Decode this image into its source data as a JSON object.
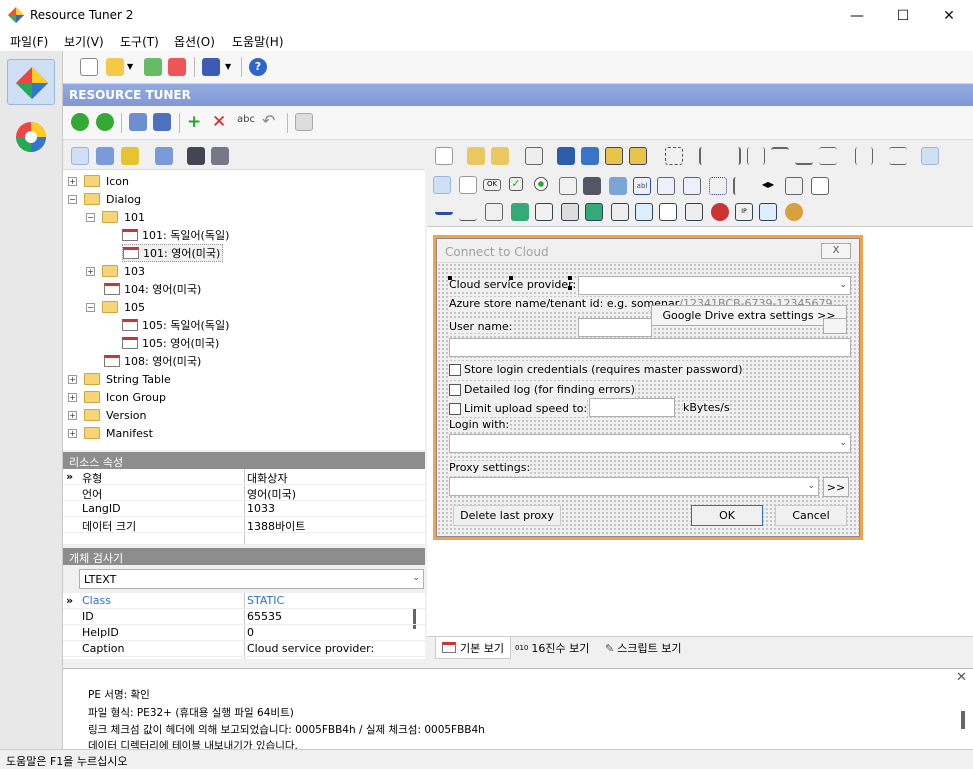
{
  "app": {
    "title": "Resource Tuner 2"
  },
  "menu": [
    "파일(F)",
    "보기(V)",
    "도구(T)",
    "옵션(O)",
    "도움말(H)"
  ],
  "header": {
    "label": "RESOURCE TUNER"
  },
  "tree": [
    {
      "label": "Icon"
    },
    {
      "label": "Dialog"
    },
    {
      "label": "101"
    },
    {
      "label": "101: 독일어(독일)"
    },
    {
      "label": "101: 영어(미국)"
    },
    {
      "label": "103"
    },
    {
      "label": "104: 영어(미국)"
    },
    {
      "label": "105"
    },
    {
      "label": "105: 독일어(독일)"
    },
    {
      "label": "105: 영어(미국)"
    },
    {
      "label": "108: 영어(미국)"
    },
    {
      "label": "String Table"
    },
    {
      "label": "Icon Group"
    },
    {
      "label": "Version"
    },
    {
      "label": "Manifest"
    }
  ],
  "resource_props": {
    "title": "리소스 속성",
    "rows": [
      {
        "k": "유형",
        "v": "대화상자"
      },
      {
        "k": "언어",
        "v": "영어(미국)"
      },
      {
        "k": "LangID",
        "v": "1033"
      },
      {
        "k": "데이터 크기",
        "v": "1388바이트"
      }
    ]
  },
  "inspector": {
    "title": "개체 검사기",
    "selected": "LTEXT",
    "rows": [
      {
        "k": "Class",
        "v": "STATIC"
      },
      {
        "k": "ID",
        "v": "65535"
      },
      {
        "k": "HelpID",
        "v": "0"
      },
      {
        "k": "Caption",
        "v": "Cloud service provider:"
      }
    ]
  },
  "dialog": {
    "title": "Connect to Cloud",
    "close": "X",
    "cloud_provider": "Cloud service provider:",
    "azure": "Azure store name/tenant id: e.g. somenar",
    "azure_hidden": "/12341BCB-6739-12345679",
    "gdrive": "Google Drive extra settings >>",
    "user": "User name:",
    "store_login": "Store login credentials (requires master password)",
    "detailed_log": "Detailed log (for finding errors)",
    "limit_upload": "Limit upload speed to:",
    "kbytes": "kBytes/s",
    "login_with": "Login with:",
    "proxy": "Proxy settings:",
    "proxy_btn": ">>",
    "delete_proxy": "Delete last proxy",
    "ok": "OK",
    "cancel": "Cancel"
  },
  "view_tabs": [
    "기본 보기",
    "16진수 보기",
    "스크립트 보기"
  ],
  "output": [
    "PE 서명: 확인",
    "파일 형식: PE32+ (휴대용 실행 파일 64비트)",
    "링크 체크섬 값이 헤더에 의해 보고되었습니다: 0005FBB4h / 실제 체크섬: 0005FBB4h",
    "데이터 디렉터리에 테이블 내보내기가 있습니다."
  ],
  "status": "도움말은 F1을 누르십시오"
}
